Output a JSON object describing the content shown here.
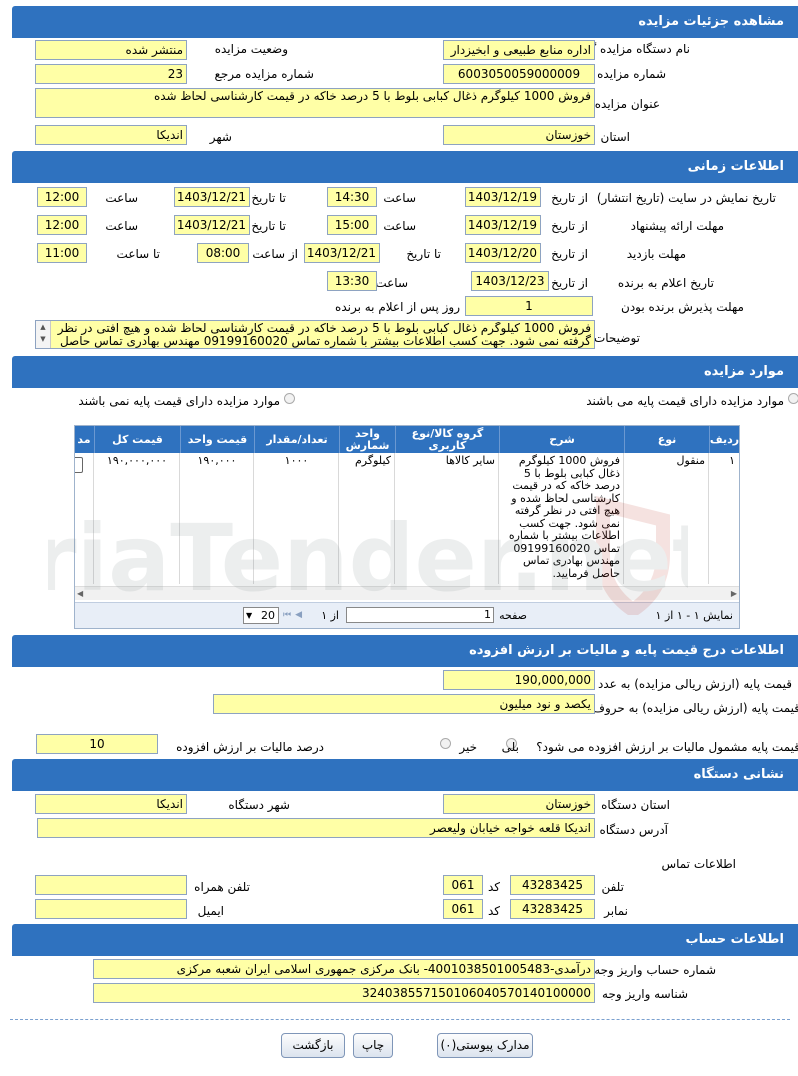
{
  "section_titles": {
    "details": "مشاهده جزئیات مزایده",
    "timing": "اطلاعات زمانی",
    "items": "موارد مزایده",
    "pricing": "اطلاعات درج قیمت پایه و مالیات بر ارزش افزوده",
    "address": "نشانی دستگاه",
    "account": "اطلاعات حساب"
  },
  "details": {
    "org_label": "نام دستگاه مزایده گزار",
    "org_value": "اداره منابع طبیعی و ابخیزدار",
    "status_label": "وضعیت مزایده",
    "status_value": "منتشر شده",
    "number_label": "شماره مزایده",
    "number_value": "6003050059000009",
    "ref_label": "شماره مزایده مرجع",
    "ref_value": "23",
    "title_label": "عنوان مزایده",
    "title_value": "فروش 1000 کیلوگرم ذغال کبابی بلوط با 5 درصد خاکه در قیمت کارشناسی لحاظ شده",
    "province_label": "استان",
    "province_value": "خوزستان",
    "city_label": "شهر",
    "city_value": "اندیکا"
  },
  "timing": {
    "from_date": "از تاریخ",
    "to_date": "تا تاریخ",
    "time": "ساعت",
    "to_time": "تا ساعت",
    "from_time": "از ساعت",
    "display_label": "تاریخ نمایش در سایت (تاریخ انتشار)",
    "display_from_date": "1403/12/19",
    "display_from_time": "14:30",
    "display_to_date": "1403/12/21",
    "display_to_time": "12:00",
    "offer_label": "مهلت ارائه پیشنهاد",
    "offer_from_date": "1403/12/19",
    "offer_from_time": "15:00",
    "offer_to_date": "1403/12/21",
    "offer_to_time": "12:00",
    "visit_label": "مهلت بازدید",
    "visit_from_date": "1403/12/20",
    "visit_to_date": "1403/12/21",
    "visit_from_time": "08:00",
    "visit_to_time": "11:00",
    "winner_label": "تاریخ اعلام به برنده",
    "winner_date": "1403/12/23",
    "winner_time": "13:30",
    "accept_label": "مهلت پذیرش برنده بودن",
    "accept_value": "1",
    "accept_suffix": "روز پس از اعلام به برنده",
    "desc_label": "توضیحات",
    "desc_value": "فروش 1000 کیلوگرم ذغال کبابی بلوط با 5 درصد خاکه در قیمت کارشناسی لحاظ شده و هیچ افتی در نظر گرفته نمی شود. جهت کسب اطلاعات بیشتر با شماره تماس 09199160020 مهندس بهادری تماس حاصل"
  },
  "items": {
    "radio_has_price": "موارد مزایده دارای قیمت پایه می باشند",
    "radio_no_price": "موارد مزایده دارای قیمت پایه نمی باشند",
    "columns": [
      "ردیف",
      "نوع",
      "شرح",
      "گروه کالا/نوع کاربری",
      "واحد شمارش",
      "تعداد/مقدار",
      "قیمت واحد",
      "قیمت کل",
      "مد"
    ],
    "row": {
      "index": "۱",
      "type": "منقول",
      "description": "فروش 1000 کیلوگرم ذغال کبابی بلوط با 5 درصد خاکه که در قیمت کارشناسی لحاظ شده و هیچ افتی در نظر گرفته نمی شود. جهت کسب اطلاعات بیشتر با شماره تماس 09199160020 مهندس بهادری تماس حاصل فرمایید.",
      "group": "سایر کالاها",
      "unit": "کیلوگرم",
      "quantity": "۱۰۰۰",
      "unit_price": "۱۹۰,۰۰۰",
      "total_price": "۱۹۰,۰۰۰,۰۰۰"
    },
    "pager_display": "نمایش ۱ - ۱ از ۱",
    "page_label": "صفحه",
    "page_value": "1",
    "page_of": "از ۱",
    "page_size": "20"
  },
  "pricing": {
    "base_num_label": "قیمت پایه (ارزش ریالی مزایده) به عدد",
    "base_num_value": "190,000,000",
    "base_text_label": "قیمت پایه (ارزش ریالی مزایده) به حروف",
    "base_text_value": "یکصد و نود میلیون",
    "vat_question": "قیمت پایه مشمول مالیات بر ارزش افزوده می شود؟",
    "yes": "بلی",
    "no": "خیر",
    "vat_pct_label": "درصد مالیات بر ارزش افزوده",
    "vat_pct_value": "10"
  },
  "address": {
    "province_label": "استان دستگاه",
    "province_value": "خوزستان",
    "city_label": "شهر دستگاه",
    "city_value": "اندیکا",
    "addr_label": "آدرس دستگاه",
    "addr_value": "اندیکا قلعه خواجه خیابان ولیعصر",
    "contact_label": "اطلاعات تماس",
    "phone_label": "تلفن",
    "phone_value": "43283425",
    "code_label": "کد",
    "phone_code": "061",
    "mobile_label": "تلفن همراه",
    "fax_label": "نمابر",
    "fax_value": "43283425",
    "fax_code": "061",
    "email_label": "ایمیل"
  },
  "account": {
    "acc_label": "شماره حساب واریز وجه",
    "acc_value": "درآمدی-4001038501005483- بانک مرکزی جمهوری اسلامی ایران شعبه مرکزی",
    "id_label": "شناسه واریز وجه",
    "id_value": "324038557150106040570140100000"
  },
  "buttons": {
    "attachments": "مدارک پیوستی(۰)",
    "print": "چاپ",
    "back": "بازگشت"
  },
  "watermark_text": "AriaTender.net",
  "colors": {
    "header": "#2f72bf",
    "field": "#ffffa6"
  }
}
